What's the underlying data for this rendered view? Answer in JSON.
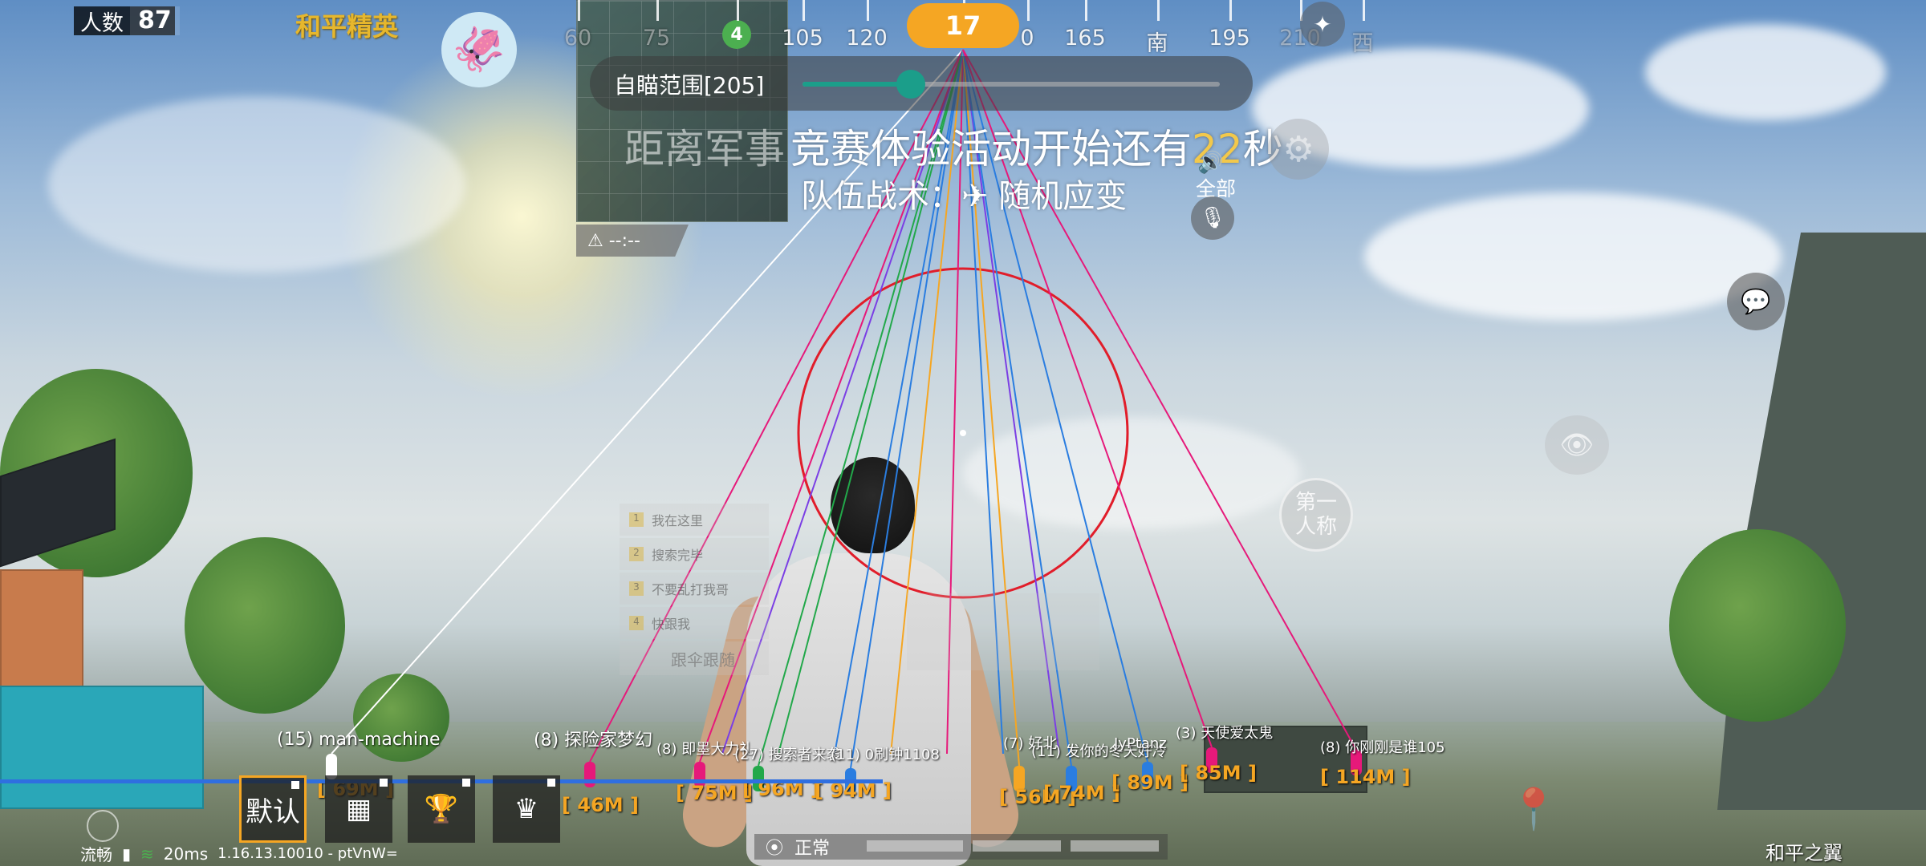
{
  "hud": {
    "player_count_label": "人数",
    "player_count": "87",
    "logo": "和平精英",
    "avatar_icon": "squid-icon",
    "heading": "17",
    "compass": [
      {
        "label": "60",
        "dim": true
      },
      {
        "label": "75",
        "dim": true
      },
      {
        "label": "",
        "dim": false
      },
      {
        "label": "105",
        "dim": false
      },
      {
        "label": "120",
        "dim": false
      },
      {
        "label": "",
        "dim": false
      },
      {
        "label": "0",
        "dim": false
      },
      {
        "label": "165",
        "dim": false
      },
      {
        "label": "南",
        "dim": false
      },
      {
        "label": "195",
        "dim": false
      },
      {
        "label": "210",
        "dim": true
      },
      {
        "label": "西",
        "dim": true
      }
    ],
    "minimap_marker": "4",
    "warn_text": "--:--",
    "aim_label": "自瞄范围[205]",
    "aim_level": 0.26,
    "banner_bg": "距离军事",
    "banner_main_prefix": "竞赛体验活动开始还有",
    "banner_main_highlight": "22",
    "banner_main_suffix": "秒",
    "banner_sub": "队伍战术：✈ 随机应变",
    "voice_all": "全部",
    "first_person_line1": "第一",
    "first_person_line2": "人称"
  },
  "enemies": [
    {
      "name": "(15) man-machine",
      "dist": "[ 69M ]",
      "color": "#ffffff"
    },
    {
      "name": "(8) 探险家梦幻",
      "dist": "[ 46M ]",
      "color": "#e6197a"
    },
    {
      "name": "(8) 即墨大力礼",
      "dist": "[ 75M ]",
      "color": "#e6197a"
    },
    {
      "name": "(27) 搜索者来袭",
      "dist": "[ 96M ]",
      "color": "#22a84a"
    },
    {
      "name": "(11) 0刷钟1108",
      "dist": "[ 94M ]",
      "color": "#2a7de0"
    },
    {
      "name": "(7) 好北",
      "dist": "[ 56M ]",
      "color": "#f5a623"
    },
    {
      "name": "(11) 发你的冬天好冷",
      "dist": "[ 74M ]",
      "color": "#2a7de0"
    },
    {
      "name": "JyPtanz",
      "dist": "[ 89M ]",
      "color": "#2a7de0"
    },
    {
      "name": "(3) 天使爱太鬼",
      "dist": "[ 85M ]",
      "color": "#e6197a"
    },
    {
      "name": "(8) 你刚刚是谁105",
      "dist": "[ 114M ]",
      "color": "#e6197a"
    }
  ],
  "quick_messages": [
    "我在这里",
    "搜索完毕",
    "不要乱打我哥",
    "快跟我"
  ],
  "follow_label": "跟伞跟随",
  "equip_slots": [
    {
      "label": "默认",
      "selected": true,
      "icon": "default-preset"
    },
    {
      "label": "",
      "selected": false,
      "icon": "pattern-icon"
    },
    {
      "label": "",
      "selected": false,
      "icon": "trophy-icon"
    },
    {
      "label": "",
      "selected": false,
      "icon": "crown-icon"
    }
  ],
  "status": {
    "fluency": "流畅",
    "ping": "20ms",
    "version": "1.16.13.10010 - ptVnW="
  },
  "mode_label": "正常",
  "watermark": "和平之翼",
  "colors": {
    "accent": "#f5a623",
    "aim_circle": "#e11d2a",
    "slider": "#1b9e8a",
    "red": "#e6197a",
    "green": "#22a84a",
    "blue": "#2a7de0",
    "orange": "#f5a623",
    "purple": "#7b3fe4",
    "white": "#ffffff"
  }
}
